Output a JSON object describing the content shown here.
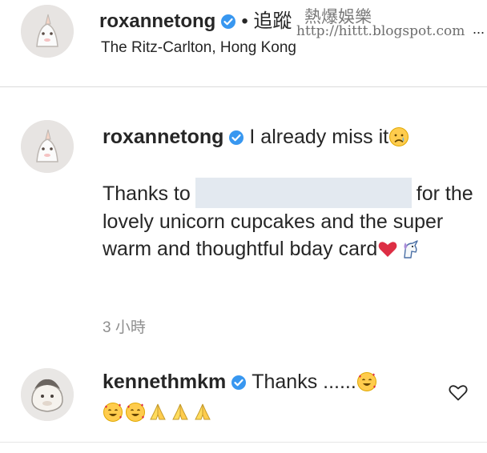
{
  "post_header": {
    "username": "roxannetong",
    "separator": "•",
    "follow_label": "追蹤",
    "location": "The Ritz-Carlton, Hong Kong",
    "watermark_title": "熱爆娛樂",
    "watermark_url": "http://hittt.blogspot.com",
    "more_label": "..."
  },
  "caption": {
    "username": "roxannetong",
    "text_line": "I already miss it",
    "body_prefix": "Thanks to",
    "body_suffix": "for the lovely unicorn cupcakes and the super warm and thoughtful bday card",
    "timestamp": "3 小時"
  },
  "reply": {
    "username": "kennethmkm",
    "text": "Thanks ......"
  },
  "icons": {
    "verified": "verified-badge-icon",
    "heart": "heart-outline-icon",
    "emojis": [
      "sad-face-emoji",
      "red-heart-emoji",
      "unicorn-emoji",
      "smiling-face-with-hearts-emoji",
      "folded-hands-emoji"
    ]
  },
  "colors": {
    "verified_blue": "#3897f0",
    "text": "#262626",
    "muted": "#8e8e8e",
    "redaction": "#e3e9f0"
  }
}
